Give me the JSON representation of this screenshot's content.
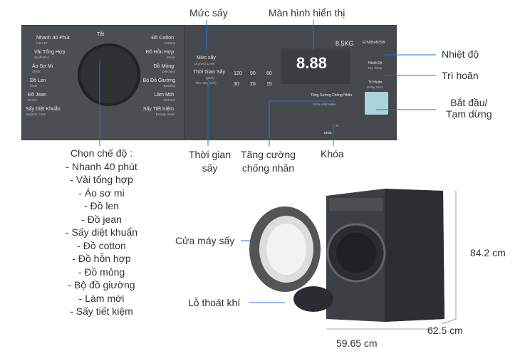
{
  "panel": {
    "off": "Tắt",
    "off_en": "Off",
    "left_programs": [
      [
        "Nhanh 40 Phút",
        "Fast 40'"
      ],
      [
        "Vải Tổng Hợp",
        "Synthetics"
      ],
      [
        "Áo Sơ Mi",
        "Shirts"
      ],
      [
        "Đồ Len",
        "Wool"
      ],
      [
        "Đồ Jean",
        "Denim"
      ],
      [
        "Sấy Diệt Khuẩn",
        "Hygienic Care"
      ]
    ],
    "right_programs": [
      [
        "Đồ Cotton",
        "Cottons"
      ],
      [
        "Đồ Hỗn Hợp",
        "Mixed"
      ],
      [
        "Đồ Mỏng",
        "Delicates"
      ],
      [
        "Bộ Đồ Giường",
        "Bedding"
      ],
      [
        "Làm Mới",
        "Refresh"
      ],
      [
        "Sấy Tiết Kiệm",
        "Energy Saver"
      ]
    ],
    "capacity": "8.5KG",
    "model": "EDV854N3SB",
    "dry_level": "Mức sấy",
    "dry_level_en": "Dryness Level",
    "dry_time": "Thời Gian Sấy",
    "dry_time_unit": "(phút)",
    "dry_time_en": "Time Dry (min)",
    "time_options": [
      "120",
      "90",
      "60",
      "30",
      "20",
      "15"
    ],
    "display": "8.88",
    "anti_crease": "Tăng Cường Chống Nhăn",
    "anti_crease_en": "Extra Anticrease",
    "lock": "Khóa",
    "lock_en": "Lock",
    "lock_hold": "2s",
    "temp": "Nhiệt Độ",
    "temp_en": "Dry Temp",
    "delay": "Trì Hoãn",
    "delay_en": "Delay Start"
  },
  "callouts": {
    "dry_level": "Mức sấy",
    "display": "Màn hình hiển thị",
    "temperature": "Nhiệt độ",
    "delay": "Trì hoãn",
    "start_1": "Bắt đầu/",
    "start_2": "Tạm dừng",
    "time_1": "Thời gian",
    "time_2": "sấy",
    "crease_1": "Tăng cường",
    "crease_2": "chống nhăn",
    "lock": "Khóa",
    "door": "Cửa máy sấy",
    "vent": "Lỗ thoát khí"
  },
  "modes": {
    "title": "Chọn chế độ :",
    "items": [
      "- Nhanh 40 phút",
      "- Vải tổng hợp",
      "- Áo sơ mi",
      "- Đồ len",
      "- Đồ jean",
      "- Sấy diệt khuẩn",
      "- Đồ cotton",
      "- Đồ hỗn hợp",
      "- Đồ mỏng",
      "- Bộ đồ giường",
      "- Làm mới",
      "- Sấy tiết kiệm"
    ]
  },
  "dimensions": {
    "height": "84.2 cm",
    "depth": "62.5 cm",
    "width": "59.65 cm"
  },
  "colors": {
    "callout_line": "#1a73e8",
    "panel": "#4b4e53",
    "machine": "#3c3f44"
  }
}
